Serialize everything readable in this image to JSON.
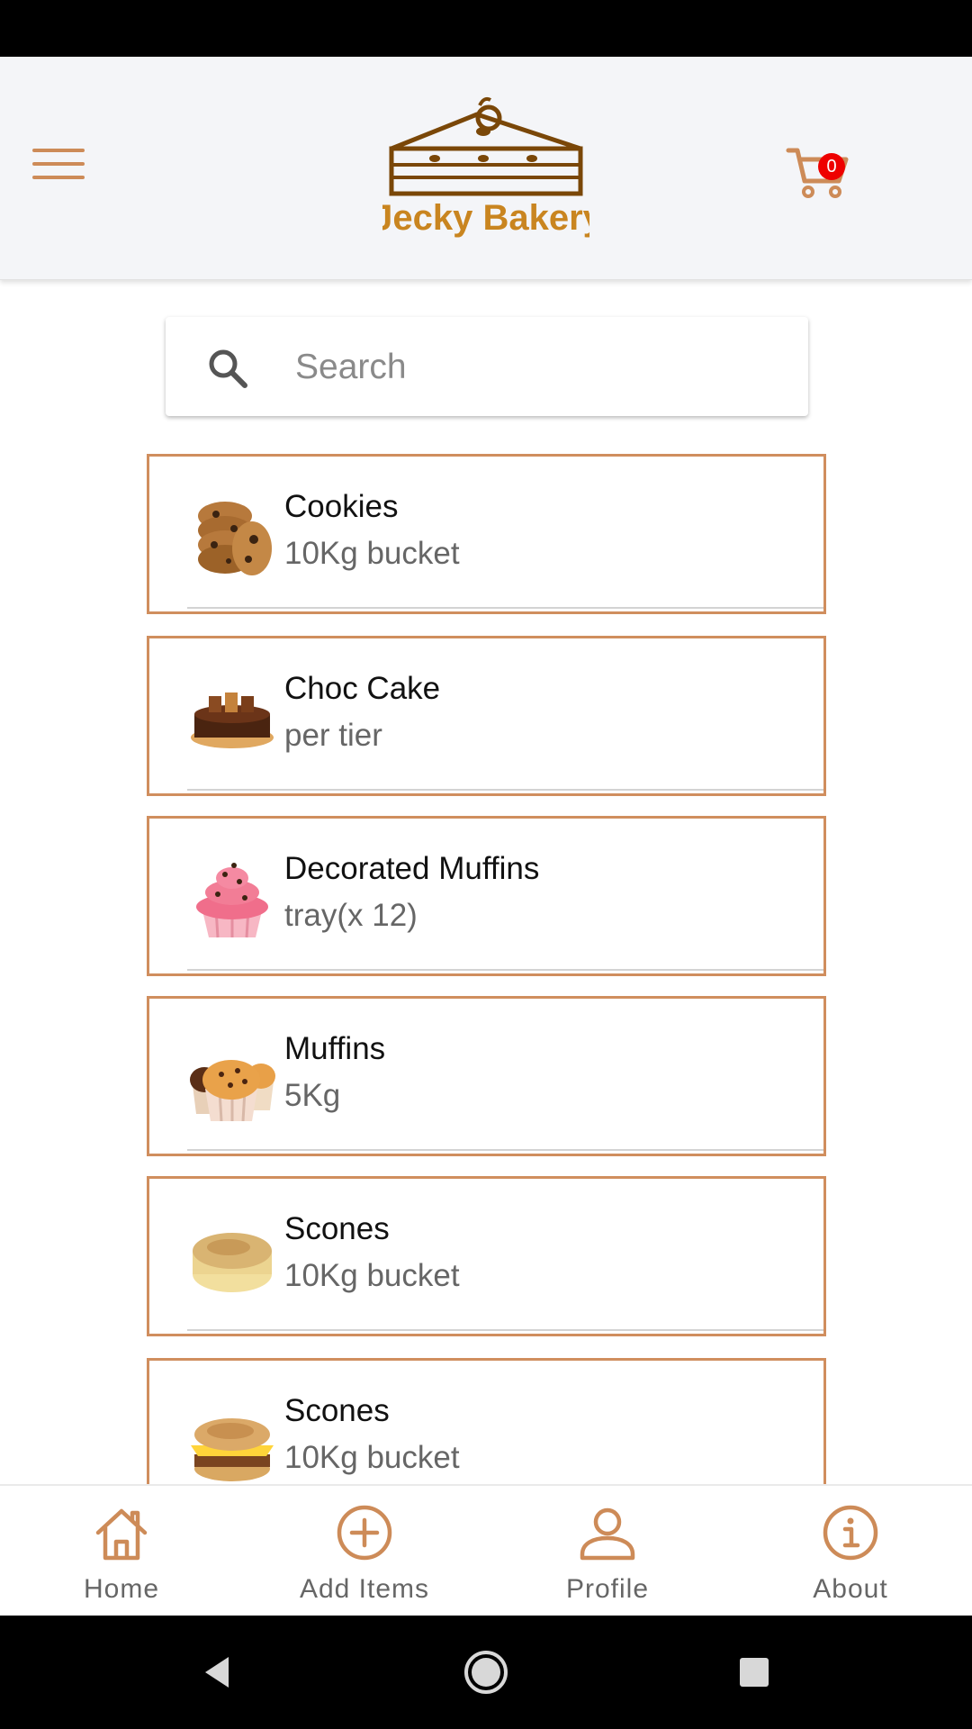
{
  "header": {
    "brand_name": "Jecky Bakery",
    "cart_count": "0",
    "accent_color": "#cd8b58"
  },
  "search": {
    "placeholder": "Search"
  },
  "products": [
    {
      "name": "Cookies",
      "unit": "10Kg bucket",
      "image": "cookies-image"
    },
    {
      "name": "Choc Cake",
      "unit": "per tier",
      "image": "choc-cake-image"
    },
    {
      "name": "Decorated Muffins",
      "unit": "tray(x 12)",
      "image": "decorated-muffin-image"
    },
    {
      "name": "Muffins",
      "unit": "5Kg",
      "image": "muffins-image"
    },
    {
      "name": "Scones",
      "unit": "10Kg bucket",
      "image": "scone-image"
    },
    {
      "name": "Scones",
      "unit": "10Kg bucket",
      "image": "scone-sandwich-image"
    }
  ],
  "bottom_nav": [
    {
      "label": "Home",
      "icon": "home-icon"
    },
    {
      "label": "Add Items",
      "icon": "add-circle-icon"
    },
    {
      "label": "Profile",
      "icon": "person-icon"
    },
    {
      "label": "About",
      "icon": "info-icon"
    }
  ],
  "system_nav": [
    "back-icon",
    "home-circle-icon",
    "recents-icon"
  ]
}
